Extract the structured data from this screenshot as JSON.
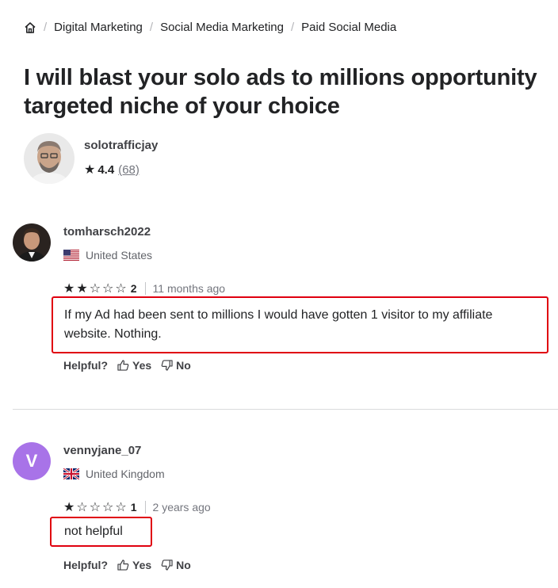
{
  "breadcrumb": {
    "items": [
      "Digital Marketing",
      "Social Media Marketing",
      "Paid Social Media"
    ]
  },
  "gig": {
    "title": "I will blast your solo ads to millions opportunity targeted niche of your choice"
  },
  "seller": {
    "name": "solotrafficjay",
    "rating": "4.4",
    "review_count": "(68)"
  },
  "reviews": [
    {
      "username": "tomharsch2022",
      "country": "United States",
      "rating": "2",
      "stars_filled": 2,
      "time": "11 months ago",
      "text": "If my Ad had been sent to millions I would have gotten 1 visitor to my affiliate website. Nothing.",
      "helpful_label": "Helpful?",
      "yes_label": "Yes",
      "no_label": "No"
    },
    {
      "username": "vennyjane_07",
      "avatar_letter": "V",
      "country": "United Kingdom",
      "rating": "1",
      "stars_filled": 1,
      "time": "2 years ago",
      "text": "not helpful",
      "helpful_label": "Helpful?",
      "yes_label": "Yes",
      "no_label": "No"
    }
  ],
  "colors": {
    "highlight_border": "#e0000f",
    "letter_avatar_bg": "#a873e8"
  }
}
